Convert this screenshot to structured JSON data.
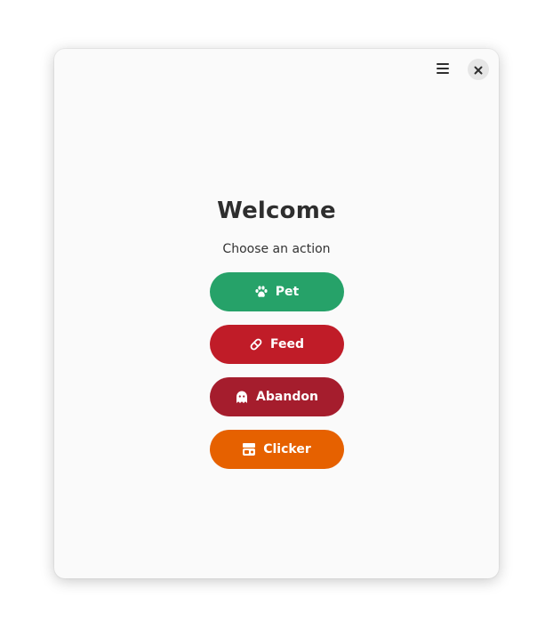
{
  "window": {
    "menu_icon": "hamburger-menu-icon",
    "close_icon": "close-icon"
  },
  "main": {
    "title": "Welcome",
    "subtitle": "Choose an action"
  },
  "actions": [
    {
      "label": "Pet",
      "icon": "paw-icon",
      "color": "#26a269"
    },
    {
      "label": "Feed",
      "icon": "capsule-icon",
      "color": "#c01c28"
    },
    {
      "label": "Abandon",
      "icon": "ghost-icon",
      "color": "#a51d2d"
    },
    {
      "label": "Clicker",
      "icon": "clicker-icon",
      "color": "#e66100"
    }
  ]
}
